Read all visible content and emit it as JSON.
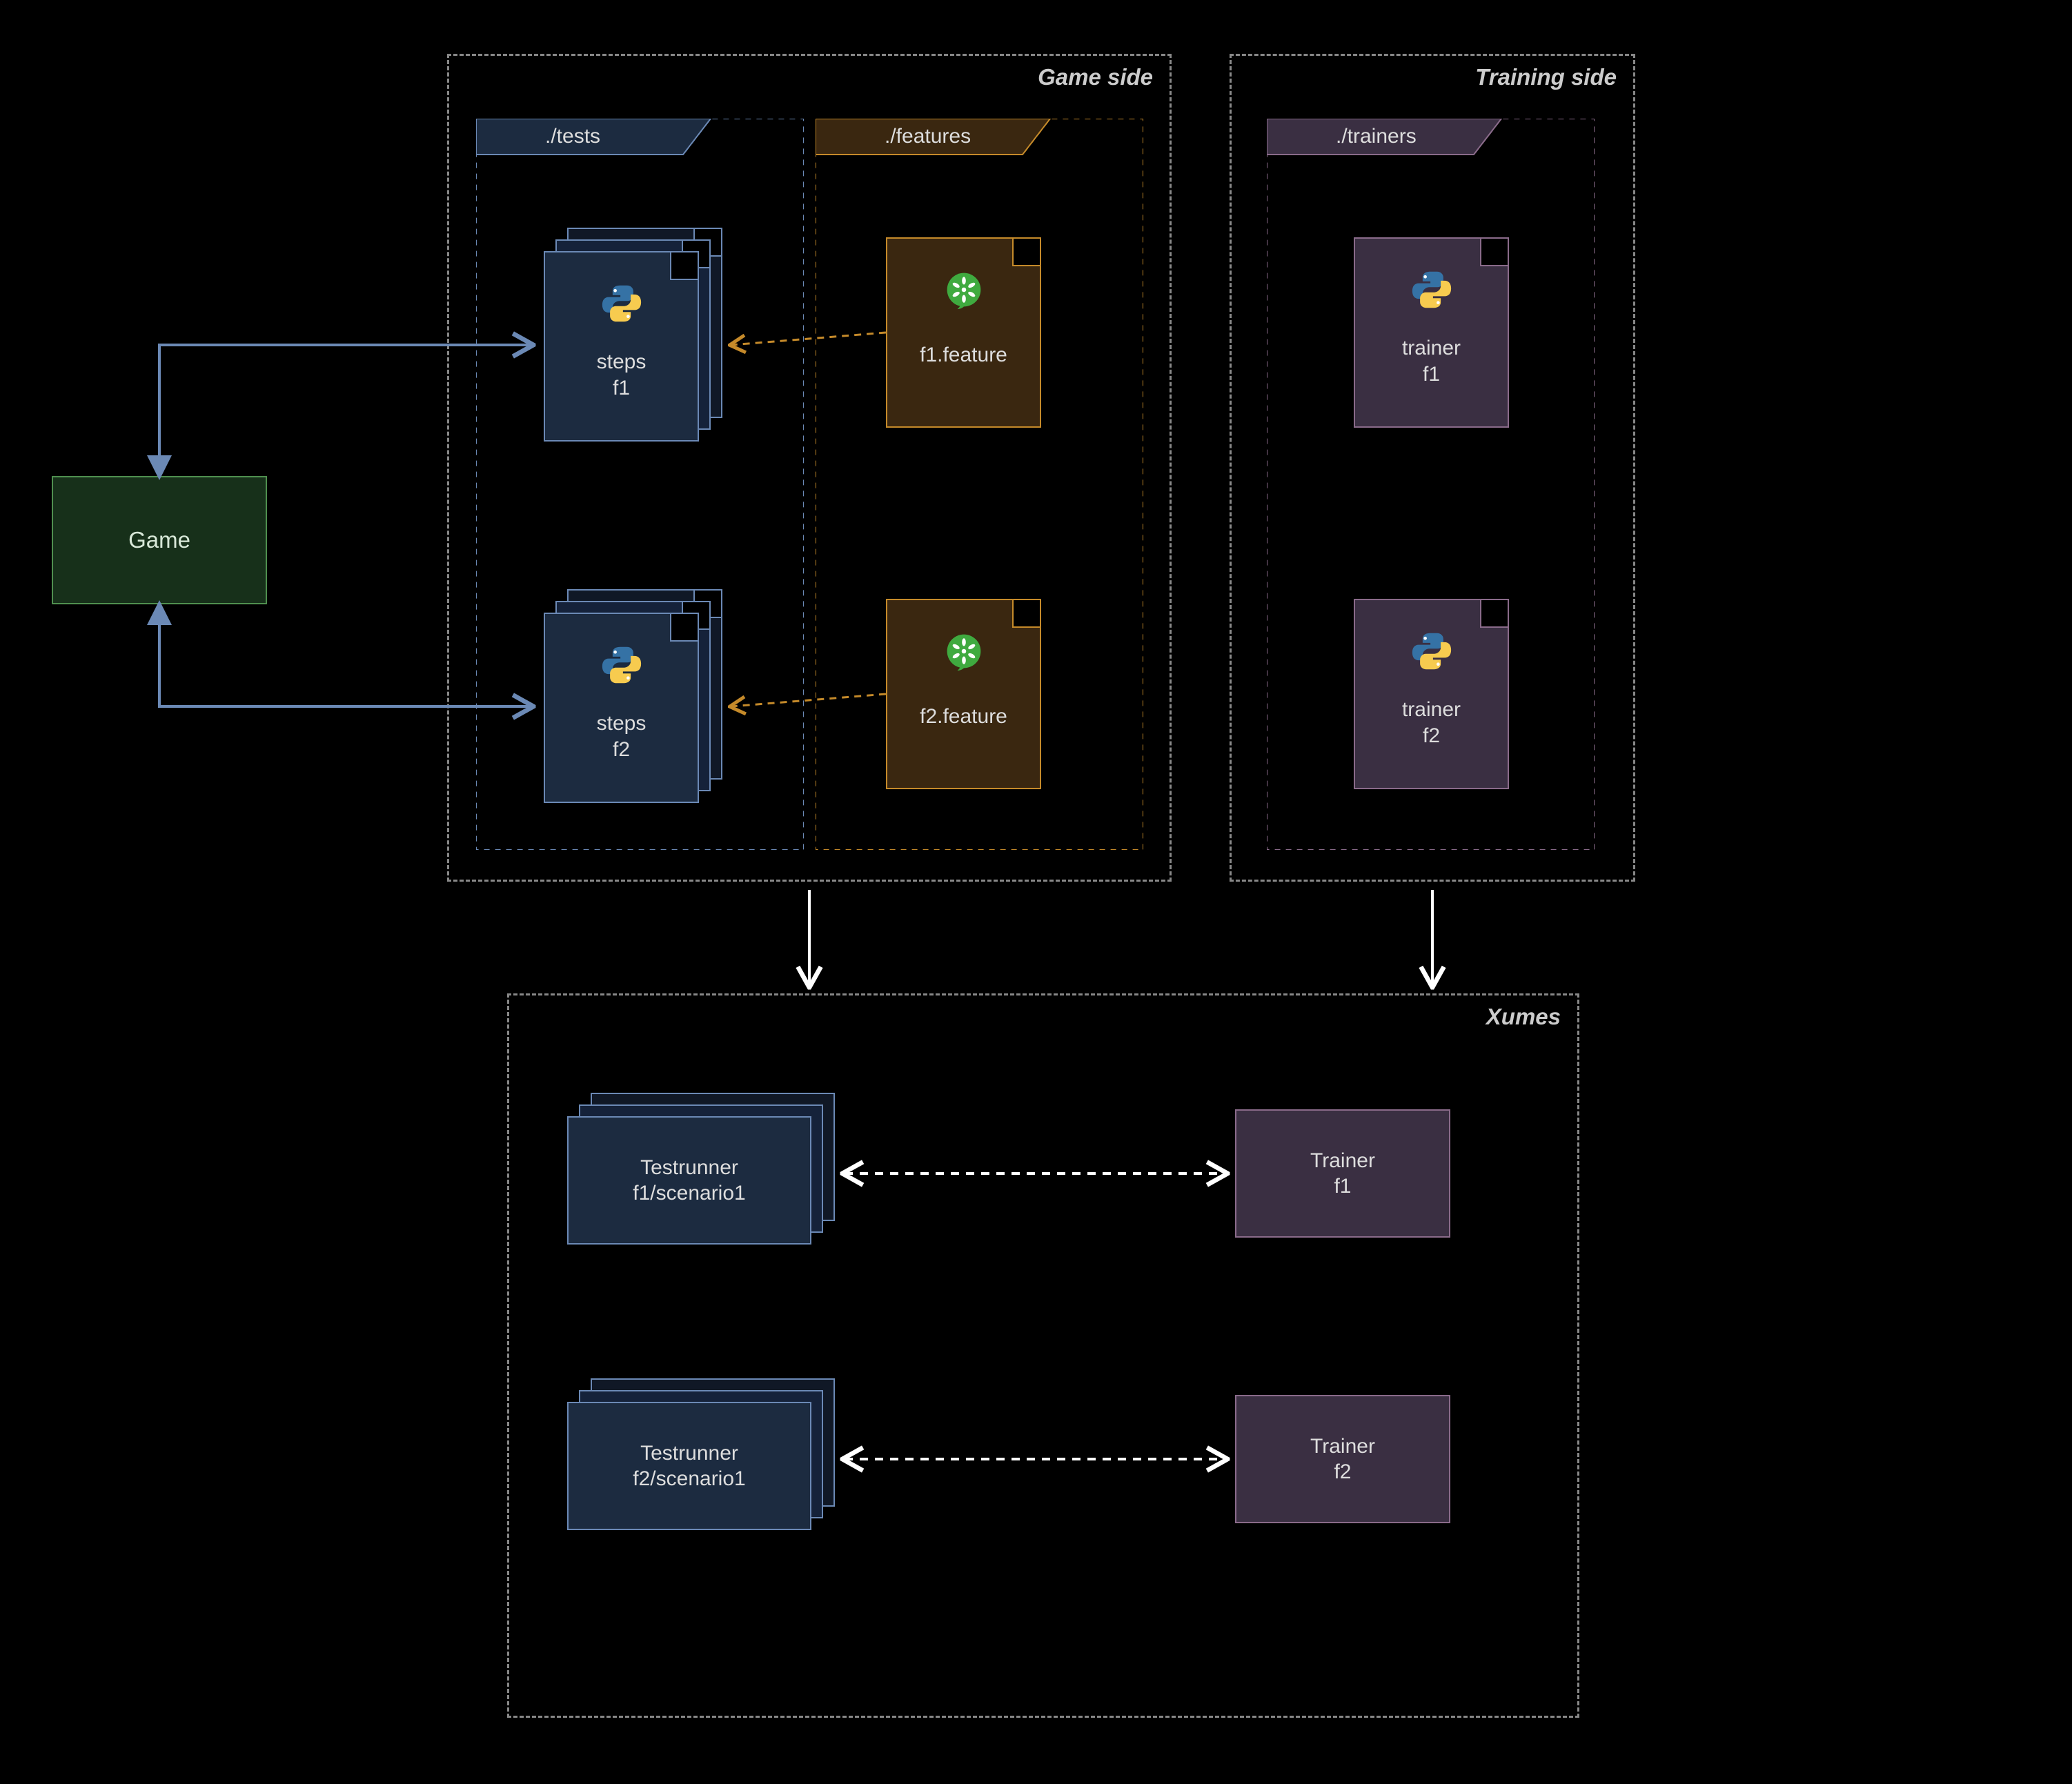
{
  "panels": {
    "game_side": "Game side",
    "training_side": "Training side",
    "xumes": "Xumes"
  },
  "folders": {
    "tests": "./tests",
    "features": "./features",
    "trainers": "./trainers"
  },
  "files": {
    "steps_f1_l1": "steps",
    "steps_f1_l2": "f1",
    "steps_f2_l1": "steps",
    "steps_f2_l2": "f2",
    "feature_f1": "f1.feature",
    "feature_f2": "f2.feature",
    "trainer_f1_l1": "trainer",
    "trainer_f1_l2": "f1",
    "trainer_f2_l1": "trainer",
    "trainer_f2_l2": "f2"
  },
  "boxes": {
    "game": "Game",
    "testrunner1_l1": "Testrunner",
    "testrunner1_l2": "f1/scenario1",
    "testrunner2_l1": "Testrunner",
    "testrunner2_l2": "f2/scenario1",
    "trainer1_l1": "Trainer",
    "trainer1_l2": "f1",
    "trainer2_l1": "Trainer",
    "trainer2_l2": "f2"
  },
  "colors": {
    "blue_border": "#6b89b5",
    "blue_fill": "#1c2b40",
    "orange_border": "#c58a2a",
    "orange_fill": "#3a2710",
    "purple_border": "#8a6b8a",
    "purple_fill": "#3a2f42",
    "green_border": "#4f8f4f",
    "green_fill": "#17301a",
    "cucumber": "#3faa3f",
    "panel_dash": "#888"
  }
}
